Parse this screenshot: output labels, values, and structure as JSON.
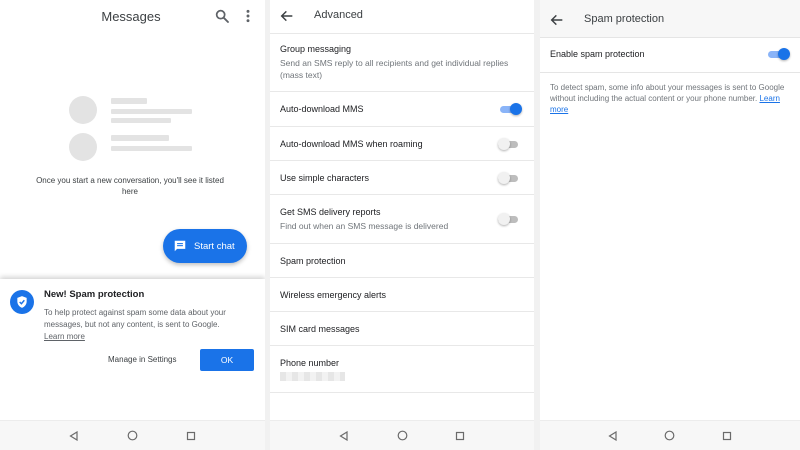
{
  "messages": {
    "title": "Messages",
    "empty_text": "Once you start a new conversation, you'll see it listed here",
    "fab_label": "Start chat",
    "sheet": {
      "title": "New! Spam protection",
      "body": "To help protect against spam some data about your messages, but not any content, is sent to Google.",
      "learn_more": "Learn more",
      "manage": "Manage in Settings",
      "ok": "OK"
    }
  },
  "advanced": {
    "title": "Advanced",
    "rows": [
      {
        "title": "Group messaging",
        "subtitle": "Send an SMS reply to all recipients and get individual replies (mass text)"
      },
      {
        "title": "Auto-download MMS",
        "toggle": "on"
      },
      {
        "title": "Auto-download MMS when roaming",
        "toggle": "off"
      },
      {
        "title": "Use simple characters",
        "toggle": "off"
      },
      {
        "title": "Get SMS delivery reports",
        "subtitle": "Find out when an SMS message is delivered",
        "toggle": "off"
      },
      {
        "title": "Spam protection"
      },
      {
        "title": "Wireless emergency alerts"
      },
      {
        "title": "SIM card messages"
      },
      {
        "title": "Phone number"
      }
    ]
  },
  "spam": {
    "title": "Spam protection",
    "enable_label": "Enable spam protection",
    "enabled": true,
    "info": "To detect spam, some info about your messages is sent to Google without including the actual content or your phone number.",
    "learn_more": "Learn more"
  },
  "colors": {
    "accent": "#1a73e8",
    "text_primary": "#202124",
    "text_secondary": "#70757a"
  },
  "icons": {
    "search": "search-icon",
    "more": "more-vert-icon",
    "back": "arrow-back-icon",
    "chat": "chat-bubble-icon",
    "shield": "verified-shield-icon",
    "nav_back": "nav-back-icon",
    "nav_home": "nav-home-icon",
    "nav_recents": "nav-recents-icon"
  }
}
